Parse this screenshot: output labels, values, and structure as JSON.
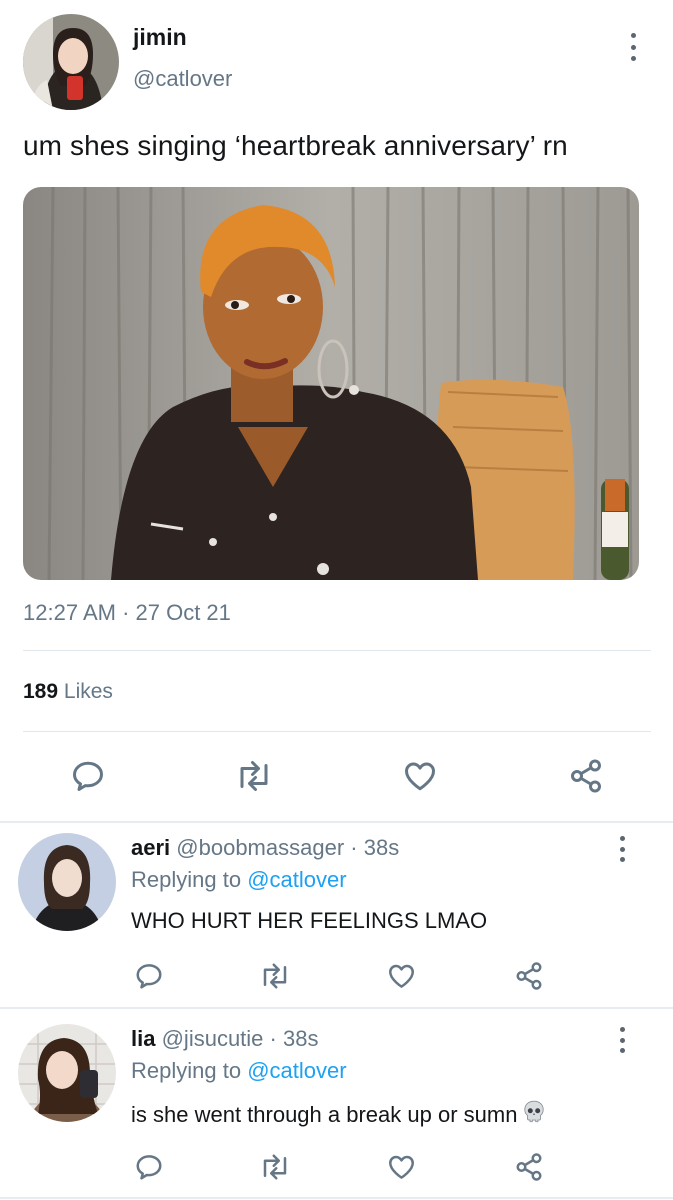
{
  "tweet": {
    "display_name": "jimin",
    "handle": "@catlover",
    "text": "um shes singing ‘heartbreak anniversary’ rn",
    "timestamp": "12:27 AM · 27 Oct 21",
    "likes_count": "189",
    "likes_label": "Likes"
  },
  "replies": [
    {
      "display_name": "aeri",
      "handle": "@boobmassager",
      "time": "· 38s",
      "replying_prefix": "Replying to",
      "replying_to": "@catlover",
      "text": "WHO HURT HER FEELINGS LMAO"
    },
    {
      "display_name": "lia",
      "handle": "@jisucutie",
      "time": "· 38s",
      "replying_prefix": "Replying to",
      "replying_to": "@catlover",
      "text": "is she went through a break up or sumn"
    }
  ],
  "icons": [
    "more-vertical-icon",
    "reply-icon",
    "retweet-icon",
    "like-icon",
    "share-icon",
    "skull-emoji-icon"
  ],
  "colors": {
    "text": "#14171a",
    "secondary": "#657786",
    "link": "#1da1f2",
    "divider": "#e1e8ed"
  }
}
